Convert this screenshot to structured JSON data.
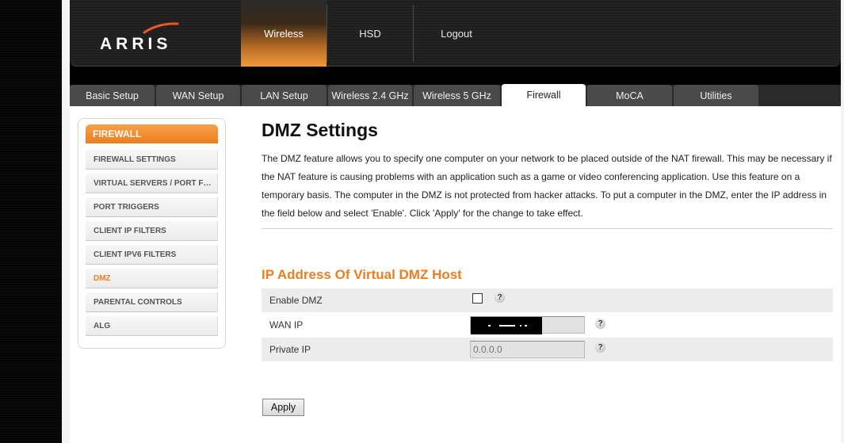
{
  "header": {
    "logo_text": "ARRIS",
    "nav": [
      {
        "label": "Wireless",
        "active": true
      },
      {
        "label": "HSD",
        "active": false
      },
      {
        "label": "Logout",
        "active": false
      }
    ]
  },
  "tabs": [
    {
      "label": "Basic Setup",
      "active": false
    },
    {
      "label": "WAN Setup",
      "active": false
    },
    {
      "label": "LAN Setup",
      "active": false
    },
    {
      "label": "Wireless 2.4 GHz",
      "active": false
    },
    {
      "label": "Wireless 5 GHz",
      "active": false
    },
    {
      "label": "Firewall",
      "active": true
    },
    {
      "label": "MoCA",
      "active": false
    },
    {
      "label": "Utilities",
      "active": false
    }
  ],
  "sidebar": {
    "heading": "FIREWALL",
    "items": [
      {
        "label": "FIREWALL SETTINGS",
        "active": false
      },
      {
        "label": "VIRTUAL SERVERS / PORT FORWARDING",
        "active": false
      },
      {
        "label": "PORT TRIGGERS",
        "active": false
      },
      {
        "label": "CLIENT IP FILTERS",
        "active": false
      },
      {
        "label": "CLIENT IPV6 FILTERS",
        "active": false
      },
      {
        "label": "DMZ",
        "active": true
      },
      {
        "label": "PARENTAL CONTROLS",
        "active": false
      },
      {
        "label": "ALG",
        "active": false
      }
    ]
  },
  "main": {
    "title": "DMZ Settings",
    "description": "The DMZ feature allows you to specify one computer on your network to be placed outside of the NAT firewall. This may be necessary if the NAT feature is causing problems with an application such as a game or video conferencing application. Use this feature on a temporary basis. The computer in the DMZ is not protected from hacker attacks. To put a computer in the DMZ, enter the IP address in the field below and select 'Enable'. Click 'Apply' for the change to take effect.",
    "section_title": "IP Address Of Virtual DMZ Host",
    "form": {
      "enable_dmz_label": "Enable DMZ",
      "enable_dmz_checked": false,
      "wan_ip_label": "WAN IP",
      "wan_ip_value": "",
      "private_ip_label": "Private IP",
      "private_ip_placeholder": "0.0.0.0",
      "help_glyph": "?"
    },
    "apply_label": "Apply"
  },
  "colors": {
    "accent": "#ee7d1f",
    "tab_bg": "#4a4a4a",
    "header_bg": "#1b1b1b"
  }
}
